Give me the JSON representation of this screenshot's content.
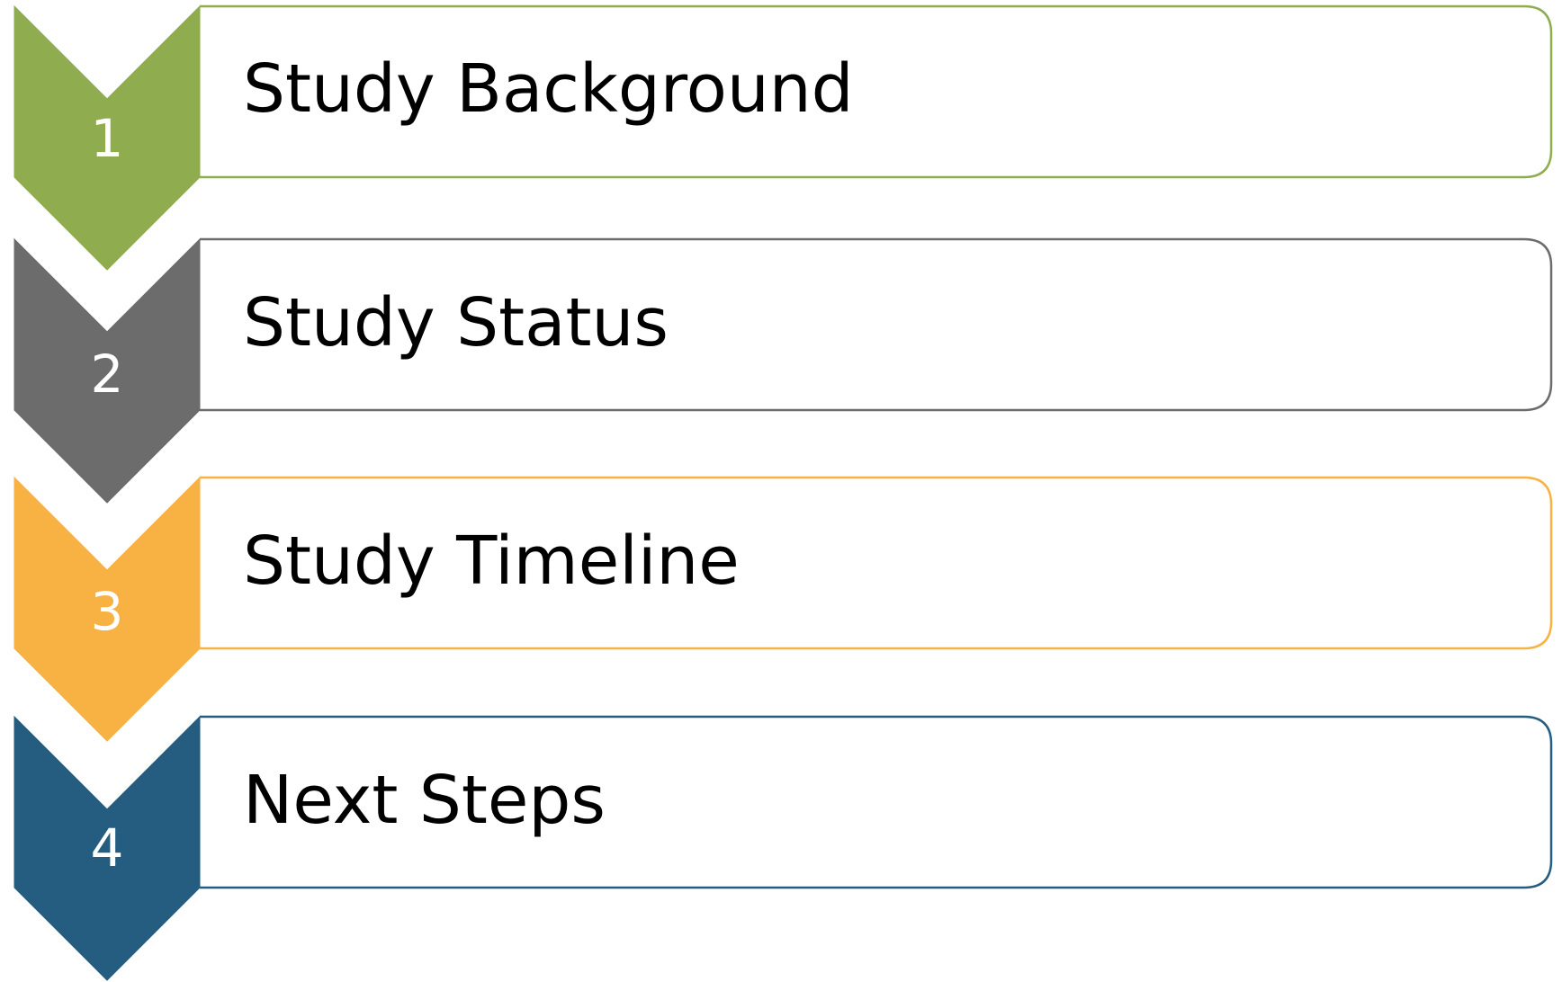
{
  "steps": [
    {
      "number": "1",
      "label": "Study Background",
      "color": "#8FAC4E"
    },
    {
      "number": "2",
      "label": "Study Status",
      "color": "#6C6C6C"
    },
    {
      "number": "3",
      "label": "Study Timeline",
      "color": "#F8B143"
    },
    {
      "number": "4",
      "label": "Next Steps",
      "color": "#245D80"
    }
  ]
}
